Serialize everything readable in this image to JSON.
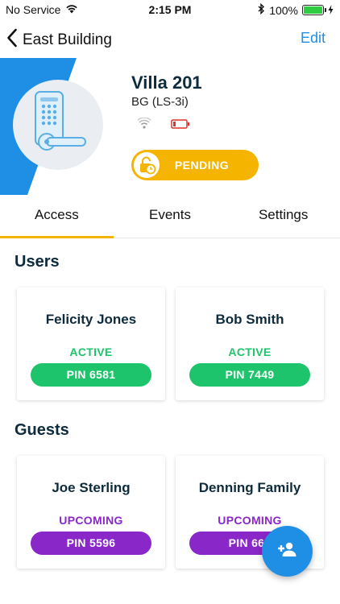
{
  "status_bar": {
    "carrier": "No Service",
    "time": "2:15 PM",
    "battery_percent": "100%"
  },
  "nav": {
    "back_label": "East Building",
    "edit_label": "Edit"
  },
  "device": {
    "name": "Villa 201",
    "model": "BG (LS-3i)",
    "status_label": "PENDING",
    "battery_level": "low"
  },
  "tabs": [
    {
      "label": "Access",
      "active": true
    },
    {
      "label": "Events",
      "active": false
    },
    {
      "label": "Settings",
      "active": false
    }
  ],
  "users": {
    "title": "Users",
    "items": [
      {
        "name": "Felicity Jones",
        "status": "ACTIVE",
        "pin": "PIN 6581"
      },
      {
        "name": "Bob Smith",
        "status": "ACTIVE",
        "pin": "PIN 7449"
      }
    ]
  },
  "guests": {
    "title": "Guests",
    "items": [
      {
        "name": "Joe Sterling",
        "status": "UPCOMING",
        "pin": "PIN 5596"
      },
      {
        "name": "Denning Family",
        "status": "UPCOMING",
        "pin": "PIN 662"
      }
    ]
  },
  "colors": {
    "accent_blue": "#1f8fe6",
    "pending_yellow": "#f5b400",
    "active_green": "#1ec46b",
    "upcoming_purple": "#8a27c9"
  }
}
